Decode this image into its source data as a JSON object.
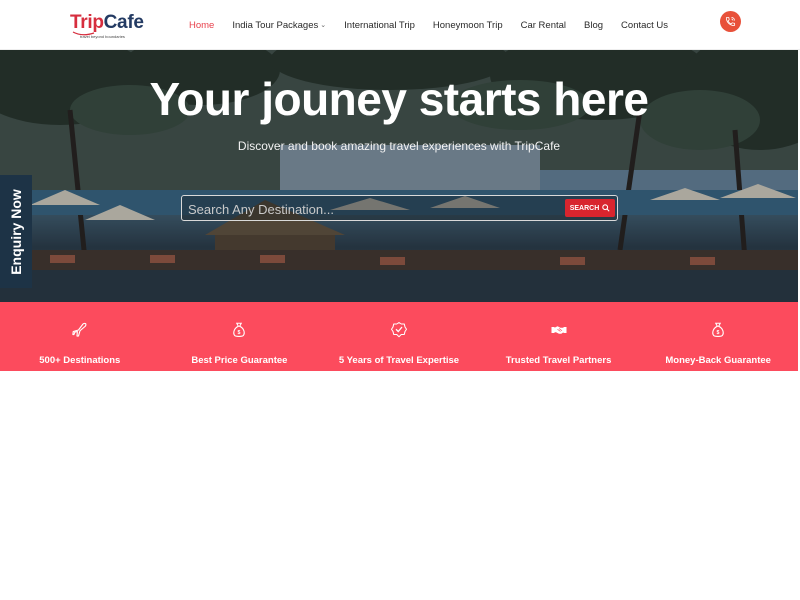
{
  "brand": {
    "name_part1": "Trip",
    "name_part2": "Cafe",
    "tagline": "travel beyond boundaries",
    "colors": {
      "trip": "#d62e3e",
      "cafe": "#243b63",
      "accent": "#fc4b5d"
    }
  },
  "nav": {
    "items": [
      {
        "label": "Home",
        "active": true,
        "has_dropdown": false
      },
      {
        "label": "India Tour Packages",
        "active": false,
        "has_dropdown": true
      },
      {
        "label": "International Trip",
        "active": false,
        "has_dropdown": false
      },
      {
        "label": "Honeymoon Trip",
        "active": false,
        "has_dropdown": false
      },
      {
        "label": "Car Rental",
        "active": false,
        "has_dropdown": false
      },
      {
        "label": "Blog",
        "active": false,
        "has_dropdown": false
      },
      {
        "label": "Contact Us",
        "active": false,
        "has_dropdown": false
      }
    ],
    "call_icon": "phone-icon"
  },
  "hero": {
    "title": "Your jouney starts here",
    "subtitle": "Discover and book amazing travel experiences with TripCafe",
    "search": {
      "placeholder": "Search Any Destination...",
      "value": "",
      "button_label": "SEARCH",
      "button_icon": "search-icon"
    }
  },
  "enquiry": {
    "label": "Enquiry Now"
  },
  "features": [
    {
      "label": "500+ Destinations",
      "icon": "airplane-icon"
    },
    {
      "label": "Best Price Guarantee",
      "icon": "money-bag-icon"
    },
    {
      "label": "5 Years of Travel Expertise",
      "icon": "shield-check-icon"
    },
    {
      "label": "Trusted Travel Partners",
      "icon": "handshake-icon"
    },
    {
      "label": "Money-Back Guarantee",
      "icon": "money-bag-icon"
    }
  ]
}
